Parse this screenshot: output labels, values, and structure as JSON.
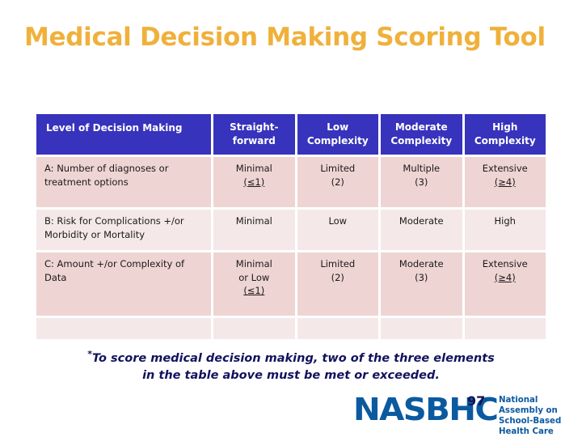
{
  "title": "Medical Decision Making Scoring Tool",
  "colors": {
    "title": "#EFB13C",
    "header_bg": "#3733BC",
    "header_text": "#FFFFFF",
    "row_dark": "#EED4D3",
    "row_light": "#F4E8E8",
    "footnote": "#12125E",
    "logo": "#0B5AA0",
    "page_number": "#141452"
  },
  "table": {
    "headers": [
      "Level of Decision Making",
      "Straight-\nforward",
      "Low\nComplexity",
      "Moderate\nComplexity",
      "High\nComplexity"
    ],
    "header_0": "Level of Decision Making",
    "header_1_line1": "Straight-",
    "header_1_line2": "forward",
    "header_2_line1": "Low",
    "header_2_line2": "Complexity",
    "header_3_line1": "Moderate",
    "header_3_line2": "Complexity",
    "header_4_line1": "High",
    "header_4_line2": "Complexity",
    "rows": [
      {
        "label": "A: Number of diagnoses or treatment options",
        "straightforward_text": "Minimal",
        "straightforward_score": "(≤1)",
        "low_text": "Limited",
        "low_score": "(2)",
        "moderate_text": "Multiple",
        "moderate_score": "(3)",
        "high_text": "Extensive",
        "high_score": "(≥4)"
      },
      {
        "label": "B: Risk for Complications +/or Morbidity or Mortality",
        "straightforward_text": "Minimal",
        "straightforward_score": "",
        "low_text": "Low",
        "low_score": "",
        "moderate_text": "Moderate",
        "moderate_score": "",
        "high_text": "High",
        "high_score": ""
      },
      {
        "label": "C: Amount +/or Complexity of Data",
        "straightforward_text": "Minimal",
        "straightforward_text2": "or Low",
        "straightforward_score": "(≤1)",
        "low_text": "Limited",
        "low_score": "(2)",
        "moderate_text": "Moderate",
        "moderate_score": "(3)",
        "high_text": "Extensive",
        "high_score": "(≥4)"
      },
      {
        "label": "",
        "straightforward_text": "",
        "straightforward_score": "",
        "low_text": "",
        "low_score": "",
        "moderate_text": "",
        "moderate_score": "",
        "high_text": "",
        "high_score": ""
      }
    ]
  },
  "footnote": {
    "star": "*",
    "line1": "To score medical decision making, two of the three elements",
    "line2": "in the table above must be met or exceeded."
  },
  "logo": {
    "mark": "NASBHC",
    "line1": "National",
    "line2": "Assembly on",
    "line3": "School-Based",
    "line4": "Health Care"
  },
  "page_number": "97"
}
